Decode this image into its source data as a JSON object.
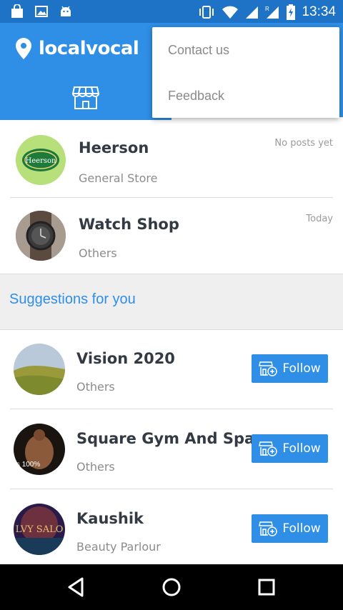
{
  "status_bar": {
    "time": "13:34",
    "left_icons": [
      "shopping-bag-icon",
      "image-icon",
      "android-icon"
    ],
    "right_icons": [
      "vibrate-icon",
      "wifi-icon",
      "signal-icon",
      "signal-roaming-icon",
      "battery-charging-icon"
    ]
  },
  "app_bar": {
    "brand": "localvocal",
    "colors": {
      "primary": "#2f8ee5",
      "status": "#1f73c6"
    }
  },
  "overflow_menu": {
    "items": [
      {
        "label": "Contact us"
      },
      {
        "label": "Feedback"
      }
    ]
  },
  "followed": [
    {
      "name": "Heerson",
      "category": "General Store",
      "meta": "No posts yet",
      "avatar_text": "Heerson"
    },
    {
      "name": "Watch Shop",
      "category": "Others",
      "meta": "Today"
    }
  ],
  "suggestions_header": "Suggestions for you",
  "suggestions": [
    {
      "name": "Vision 2020",
      "category": "Others",
      "follow_label": "Follow"
    },
    {
      "name": "Square Gym And Spa",
      "category": "Others",
      "follow_label": "Follow",
      "avatar_text": "'s 100%"
    },
    {
      "name": "Kaushik",
      "category": "Beauty Parlour",
      "follow_label": "Follow",
      "avatar_text": "LVY SALO"
    }
  ],
  "nav_bar": {
    "icons": [
      "back-icon",
      "home-icon",
      "recents-icon"
    ]
  }
}
